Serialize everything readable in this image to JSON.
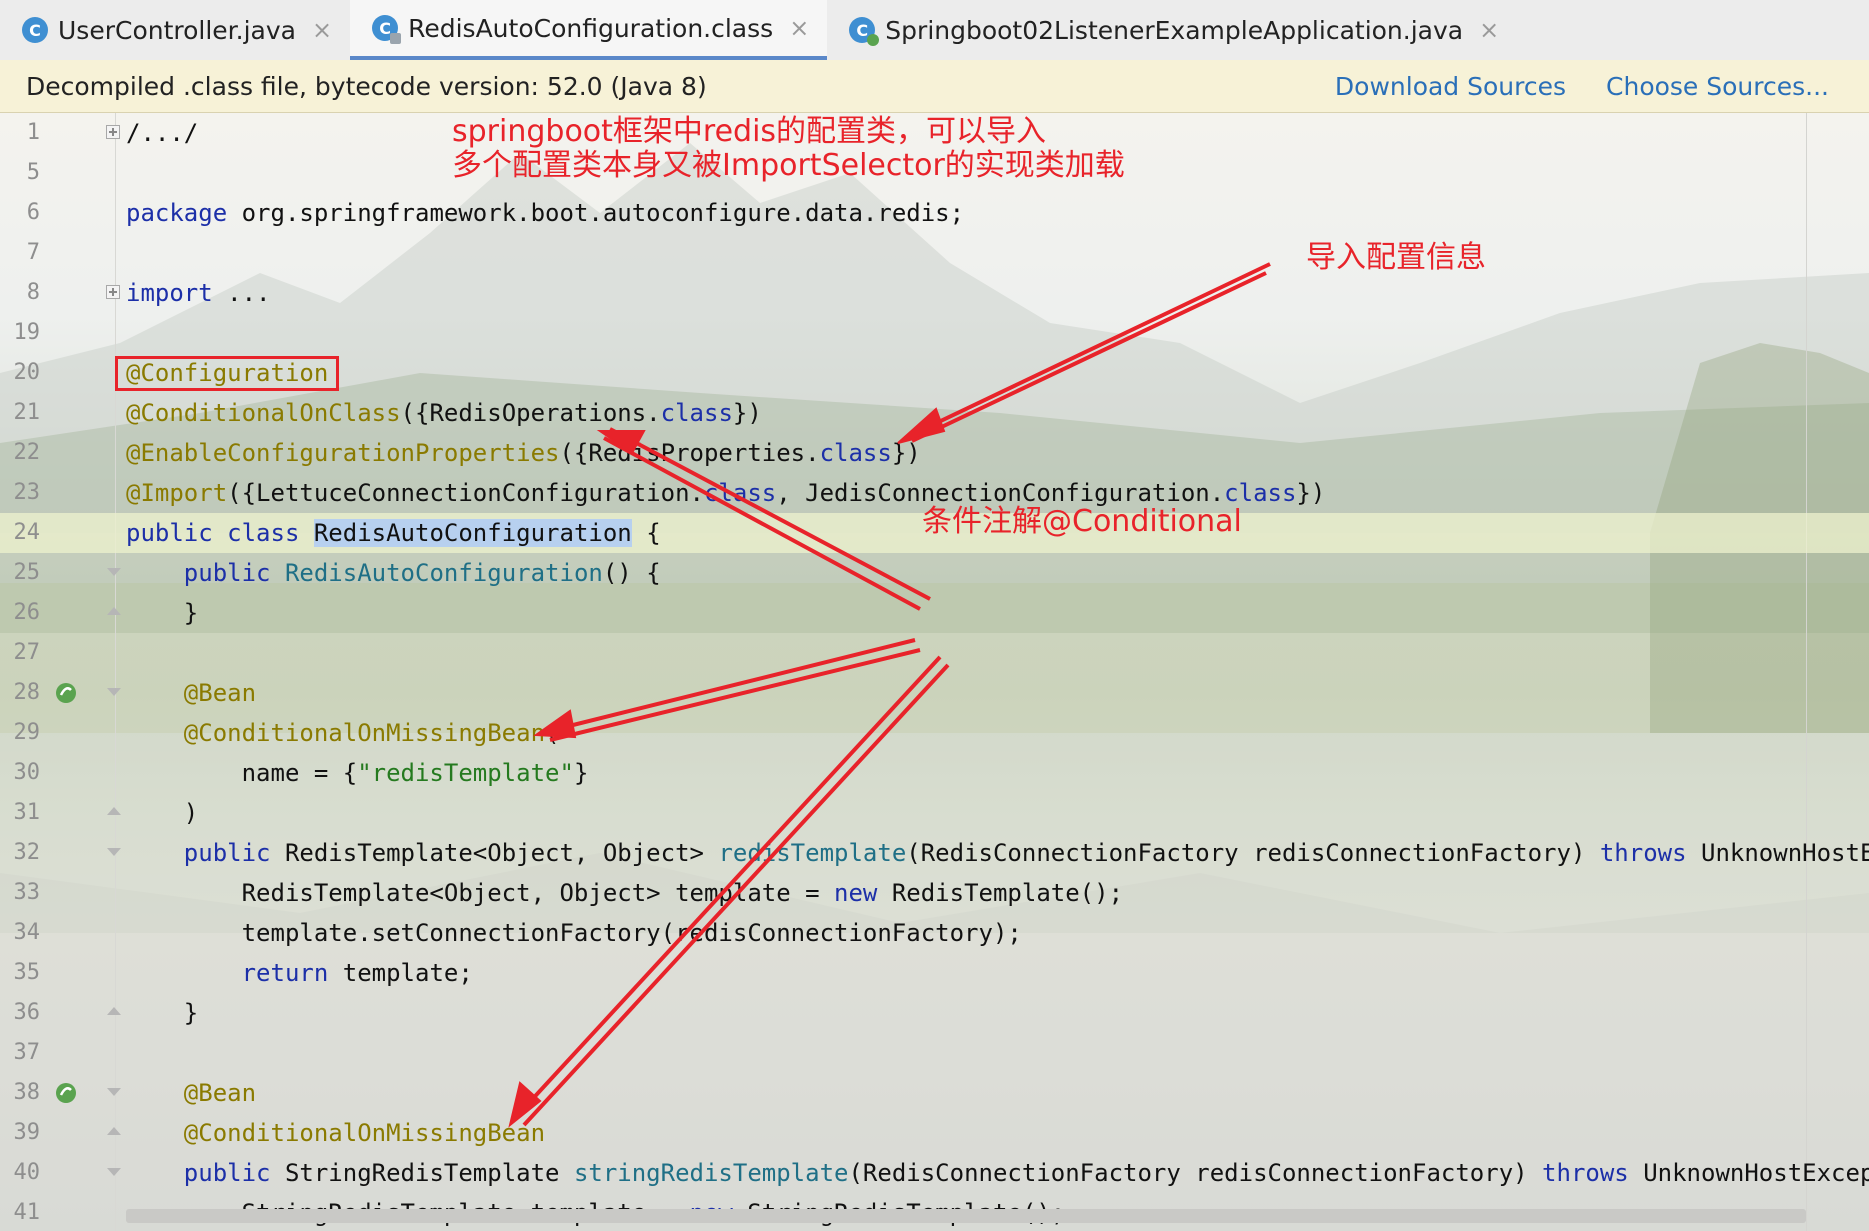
{
  "tabs": [
    {
      "label": "UserController.java",
      "icon": "java-class-icon",
      "active": false
    },
    {
      "label": "RedisAutoConfiguration.class",
      "icon": "compiled-class-icon",
      "active": true
    },
    {
      "label": "Springboot02ListenerExampleApplication.java",
      "icon": "spring-app-class-icon",
      "active": false
    }
  ],
  "banner": {
    "text": "Decompiled .class file, bytecode version: 52.0 (Java 8)",
    "download_sources": "Download Sources",
    "choose_sources": "Choose Sources..."
  },
  "code_lines": [
    {
      "num": "1",
      "text": "/.../"
    },
    {
      "num": "5",
      "text": ""
    },
    {
      "num": "6",
      "text": "package org.springframework.boot.autoconfigure.data.redis;"
    },
    {
      "num": "7",
      "text": ""
    },
    {
      "num": "8",
      "text": "import ..."
    },
    {
      "num": "19",
      "text": ""
    },
    {
      "num": "20",
      "text": "@Configuration"
    },
    {
      "num": "21",
      "text": "@ConditionalOnClass({RedisOperations.class})"
    },
    {
      "num": "22",
      "text": "@EnableConfigurationProperties({RedisProperties.class})"
    },
    {
      "num": "23",
      "text": "@Import({LettuceConnectionConfiguration.class, JedisConnectionConfiguration.class})"
    },
    {
      "num": "24",
      "text": "public class RedisAutoConfiguration {"
    },
    {
      "num": "25",
      "text": "    public RedisAutoConfiguration() {"
    },
    {
      "num": "26",
      "text": "    }"
    },
    {
      "num": "27",
      "text": ""
    },
    {
      "num": "28",
      "text": "    @Bean"
    },
    {
      "num": "29",
      "text": "    @ConditionalOnMissingBean("
    },
    {
      "num": "30",
      "text": "        name = {\"redisTemplate\"}"
    },
    {
      "num": "31",
      "text": "    )"
    },
    {
      "num": "32",
      "text": "    public RedisTemplate<Object, Object> redisTemplate(RedisConnectionFactory redisConnectionFactory) throws UnknownHostException {"
    },
    {
      "num": "33",
      "text": "        RedisTemplate<Object, Object> template = new RedisTemplate();"
    },
    {
      "num": "34",
      "text": "        template.setConnectionFactory(redisConnectionFactory);"
    },
    {
      "num": "35",
      "text": "        return template;"
    },
    {
      "num": "36",
      "text": "    }"
    },
    {
      "num": "37",
      "text": ""
    },
    {
      "num": "38",
      "text": "    @Bean"
    },
    {
      "num": "39",
      "text": "    @ConditionalOnMissingBean"
    },
    {
      "num": "40",
      "text": "    public StringRedisTemplate stringRedisTemplate(RedisConnectionFactory redisConnectionFactory) throws UnknownHostException {"
    },
    {
      "num": "41",
      "text": "        StringRedisTemplate template = new StringRedisTemplate();"
    }
  ],
  "annotations": {
    "note_top_line1": "springboot框架中redis的配置类，可以导入",
    "note_top_line2": "多个配置类本身又被ImportSelector的实现类加载",
    "note_import": "导入配置信息",
    "note_conditional": "条件注解@Conditional"
  },
  "colors": {
    "keyword": "#1c2fa8",
    "annotation": "#8a7a00",
    "string": "#257a1f",
    "method": "#1f6f86",
    "note_red": "#e8232a",
    "banner_bg": "#f7f2d7",
    "link": "#2a6fb8",
    "selection": "#b7d0ef"
  }
}
